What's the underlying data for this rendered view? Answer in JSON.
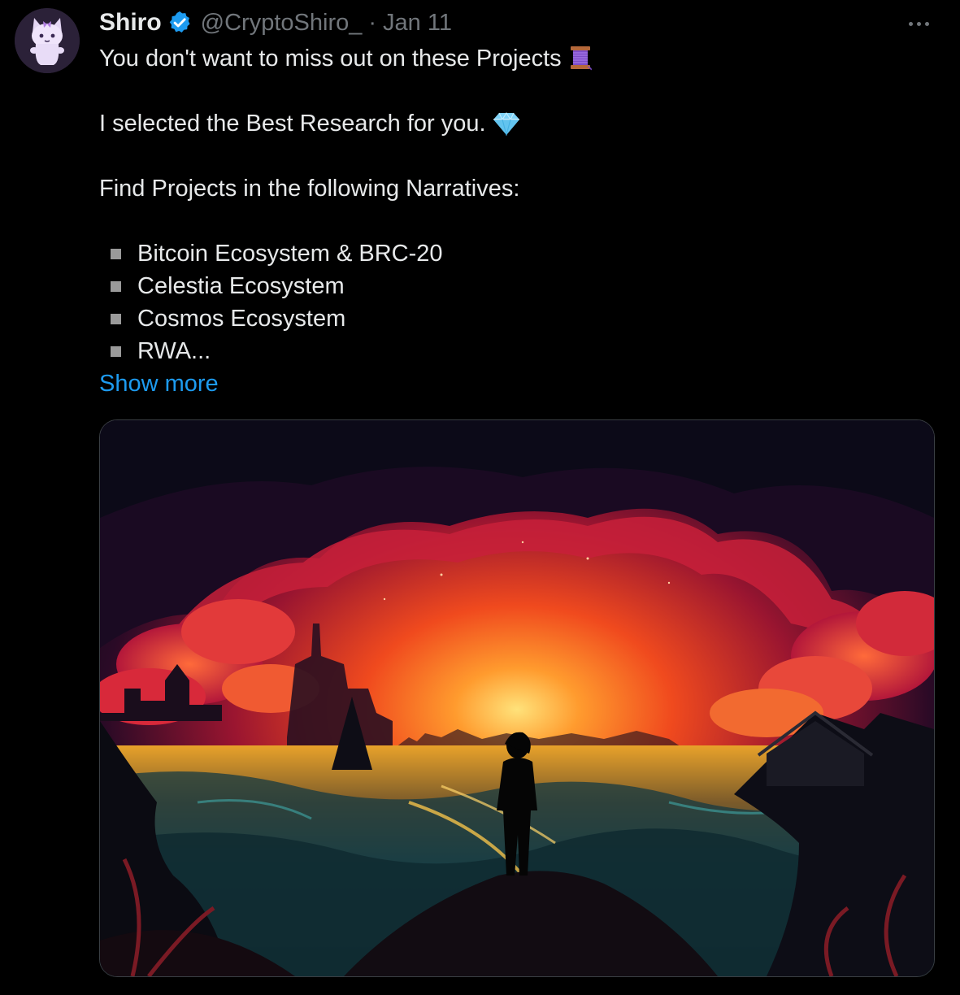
{
  "author": {
    "display_name": "Shiro",
    "handle": "@CryptoShiro_",
    "separator": "·",
    "date": "Jan 11",
    "verified": true
  },
  "post": {
    "line1": "You don't want to miss out on these Projects",
    "line1_emoji": "thread-spool-icon",
    "line2": "I selected the Best Research for you.",
    "line2_emoji": "gem-icon",
    "line3": "Find Projects in the following Narratives:",
    "bullets": [
      "Bitcoin Ecosystem & BRC-20",
      "Celestia Ecosystem",
      "Cosmos Ecosystem",
      "RWA..."
    ],
    "show_more": "Show more"
  },
  "colors": {
    "background": "#000000",
    "text": "#e7e9ea",
    "muted": "#71767b",
    "link": "#1d9bf0",
    "verified": "#1d9bf0"
  },
  "media": {
    "description_icon": "sunset-artwork-image"
  }
}
